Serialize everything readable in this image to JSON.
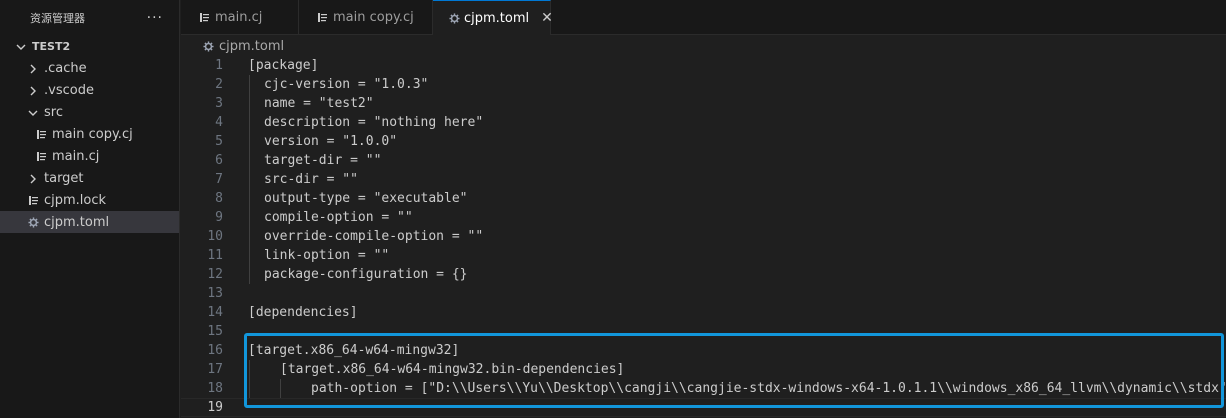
{
  "sidebar": {
    "title": "资源管理器",
    "more_label": "···",
    "root": "TEST2",
    "items": [
      {
        "label": ".cache"
      },
      {
        "label": ".vscode"
      },
      {
        "label": "src"
      },
      {
        "label": "main copy.cj"
      },
      {
        "label": "main.cj"
      },
      {
        "label": "target"
      },
      {
        "label": "cjpm.lock"
      },
      {
        "label": "cjpm.toml"
      }
    ]
  },
  "tabs": [
    {
      "label": "main.cj"
    },
    {
      "label": "main copy.cj"
    },
    {
      "label": "cjpm.toml"
    }
  ],
  "tab_close": "✕",
  "breadcrumb": "cjpm.toml",
  "editor": {
    "lines": [
      {
        "n": "1",
        "text": "[package]"
      },
      {
        "n": "2",
        "text": "cjc-version = \"1.0.3\""
      },
      {
        "n": "3",
        "text": "name = \"test2\""
      },
      {
        "n": "4",
        "text": "description = \"nothing here\""
      },
      {
        "n": "5",
        "text": "version = \"1.0.0\""
      },
      {
        "n": "6",
        "text": "target-dir = \"\""
      },
      {
        "n": "7",
        "text": "src-dir = \"\""
      },
      {
        "n": "8",
        "text": "output-type = \"executable\""
      },
      {
        "n": "9",
        "text": "compile-option = \"\""
      },
      {
        "n": "10",
        "text": "override-compile-option = \"\""
      },
      {
        "n": "11",
        "text": "link-option = \"\""
      },
      {
        "n": "12",
        "text": "package-configuration = {}"
      },
      {
        "n": "13",
        "text": ""
      },
      {
        "n": "14",
        "text": "[dependencies]"
      },
      {
        "n": "15",
        "text": ""
      },
      {
        "n": "16",
        "text": "[target.x86_64-w64-mingw32]"
      },
      {
        "n": "17",
        "text": "[target.x86_64-w64-mingw32.bin-dependencies]"
      },
      {
        "n": "18",
        "text": "path-option = [\"D:\\\\Users\\\\Yu\\\\Desktop\\\\cangji\\\\cangjie-stdx-windows-x64-1.0.1.1\\\\windows_x86_64_llvm\\\\dynamic\\\\stdx\"]"
      },
      {
        "n": "19",
        "text": ""
      }
    ]
  },
  "colors": {
    "accent": "#0078d4",
    "highlight_box": "#1296db",
    "background": "#1f1f1f",
    "sidebar_bg": "#181818",
    "selected_bg": "#37373d",
    "gear_icon": "#9da5b4"
  }
}
